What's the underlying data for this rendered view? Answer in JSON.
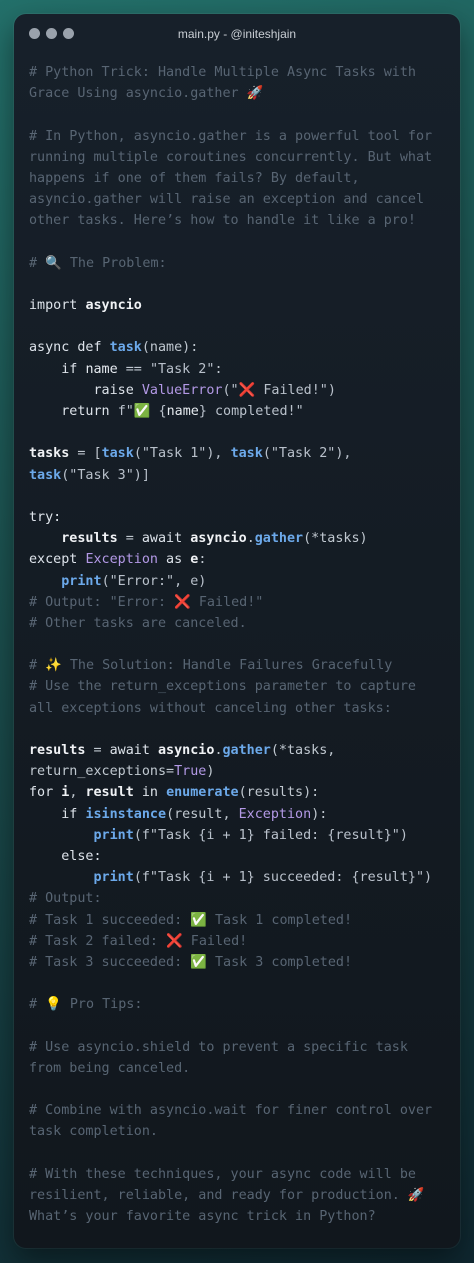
{
  "window": {
    "title": "main.py - @initeshjain"
  },
  "code_lines": [
    [
      {
        "t": "# Python Trick: Handle Multiple Async Tasks with",
        "c": "c"
      }
    ],
    [
      {
        "t": "Grace Using asyncio.gather 🚀",
        "c": "c"
      }
    ],
    [],
    [
      {
        "t": "# In Python, asyncio.gather is a powerful tool for",
        "c": "c"
      }
    ],
    [
      {
        "t": "running multiple coroutines concurrently. But what",
        "c": "c"
      }
    ],
    [
      {
        "t": "happens if one of them fails? By default,",
        "c": "c"
      }
    ],
    [
      {
        "t": "asyncio.gather will raise an exception and cancel",
        "c": "c"
      }
    ],
    [
      {
        "t": "other tasks. Here’s how to handle it like a pro!",
        "c": "c"
      }
    ],
    [],
    [
      {
        "t": "# 🔍 The Problem:",
        "c": "c"
      }
    ],
    [],
    [
      {
        "t": "import ",
        "c": "k"
      },
      {
        "t": "asyncio",
        "c": "m"
      }
    ],
    [],
    [
      {
        "t": "async def ",
        "c": "k"
      },
      {
        "t": "task",
        "c": "f"
      },
      {
        "t": "(name):",
        "c": "o"
      }
    ],
    [
      {
        "t": "    if ",
        "c": "k"
      },
      {
        "t": "name",
        "c": "v"
      },
      {
        "t": " == ",
        "c": "o"
      },
      {
        "t": "\"Task 2\"",
        "c": "s"
      },
      {
        "t": ":",
        "c": "o"
      }
    ],
    [
      {
        "t": "        raise ",
        "c": "k"
      },
      {
        "t": "ValueError",
        "c": "cl"
      },
      {
        "t": "(\"❌ Failed!\")",
        "c": "s"
      }
    ],
    [
      {
        "t": "    return ",
        "c": "k"
      },
      {
        "t": "f\"✅ {",
        "c": "s"
      },
      {
        "t": "name",
        "c": "v"
      },
      {
        "t": "} completed!\"",
        "c": "s"
      }
    ],
    [],
    [
      {
        "t": "tasks",
        "c": "m"
      },
      {
        "t": " = [",
        "c": "o"
      },
      {
        "t": "task",
        "c": "f"
      },
      {
        "t": "(\"Task 1\"), ",
        "c": "s"
      },
      {
        "t": "task",
        "c": "f"
      },
      {
        "t": "(\"Task 2\"),",
        "c": "s"
      }
    ],
    [
      {
        "t": "task",
        "c": "f"
      },
      {
        "t": "(\"Task 3\")]",
        "c": "s"
      }
    ],
    [],
    [
      {
        "t": "try:",
        "c": "k"
      }
    ],
    [
      {
        "t": "    results",
        "c": "m"
      },
      {
        "t": " = ",
        "c": "o"
      },
      {
        "t": "await ",
        "c": "k"
      },
      {
        "t": "asyncio",
        "c": "m"
      },
      {
        "t": ".",
        "c": "o"
      },
      {
        "t": "gather",
        "c": "f"
      },
      {
        "t": "(*tasks)",
        "c": "o"
      }
    ],
    [
      {
        "t": "except ",
        "c": "k"
      },
      {
        "t": "Exception",
        "c": "cl"
      },
      {
        "t": " as ",
        "c": "k"
      },
      {
        "t": "e",
        "c": "m"
      },
      {
        "t": ":",
        "c": "o"
      }
    ],
    [
      {
        "t": "    ",
        "c": "o"
      },
      {
        "t": "print",
        "c": "f"
      },
      {
        "t": "(\"Error:\", e)",
        "c": "s"
      }
    ],
    [
      {
        "t": "# Output: \"Error: ❌ Failed!\"",
        "c": "c"
      }
    ],
    [
      {
        "t": "# Other tasks are canceled.",
        "c": "c"
      }
    ],
    [],
    [
      {
        "t": "# ✨ The Solution: Handle Failures Gracefully",
        "c": "c"
      }
    ],
    [
      {
        "t": "# Use the return_exceptions parameter to capture",
        "c": "c"
      }
    ],
    [
      {
        "t": "all exceptions without canceling other tasks:",
        "c": "c"
      }
    ],
    [],
    [
      {
        "t": "results",
        "c": "m"
      },
      {
        "t": " = ",
        "c": "o"
      },
      {
        "t": "await ",
        "c": "k"
      },
      {
        "t": "asyncio",
        "c": "m"
      },
      {
        "t": ".",
        "c": "o"
      },
      {
        "t": "gather",
        "c": "f"
      },
      {
        "t": "(*tasks,",
        "c": "o"
      }
    ],
    [
      {
        "t": "return_exceptions=",
        "c": "o"
      },
      {
        "t": "True",
        "c": "b"
      },
      {
        "t": ")",
        "c": "o"
      }
    ],
    [
      {
        "t": "for ",
        "c": "k"
      },
      {
        "t": "i",
        "c": "m"
      },
      {
        "t": ", ",
        "c": "o"
      },
      {
        "t": "result",
        "c": "m"
      },
      {
        "t": " in ",
        "c": "k"
      },
      {
        "t": "enumerate",
        "c": "f"
      },
      {
        "t": "(results):",
        "c": "o"
      }
    ],
    [
      {
        "t": "    if ",
        "c": "k"
      },
      {
        "t": "isinstance",
        "c": "f"
      },
      {
        "t": "(result, ",
        "c": "o"
      },
      {
        "t": "Exception",
        "c": "cl"
      },
      {
        "t": "):",
        "c": "o"
      }
    ],
    [
      {
        "t": "        ",
        "c": "o"
      },
      {
        "t": "print",
        "c": "f"
      },
      {
        "t": "(f\"Task {i + 1} failed: {result}\")",
        "c": "s"
      }
    ],
    [
      {
        "t": "    else:",
        "c": "k"
      }
    ],
    [
      {
        "t": "        ",
        "c": "o"
      },
      {
        "t": "print",
        "c": "f"
      },
      {
        "t": "(f\"Task {i + 1} succeeded: {result}\")",
        "c": "s"
      }
    ],
    [
      {
        "t": "# Output:",
        "c": "c"
      }
    ],
    [
      {
        "t": "# Task 1 succeeded: ✅ Task 1 completed!",
        "c": "c"
      }
    ],
    [
      {
        "t": "# Task 2 failed: ❌ Failed!",
        "c": "c"
      }
    ],
    [
      {
        "t": "# Task 3 succeeded: ✅ Task 3 completed!",
        "c": "c"
      }
    ],
    [],
    [
      {
        "t": "# 💡 Pro Tips:",
        "c": "c"
      }
    ],
    [],
    [
      {
        "t": "# Use asyncio.shield to prevent a specific task",
        "c": "c"
      }
    ],
    [
      {
        "t": "from being canceled.",
        "c": "c"
      }
    ],
    [],
    [
      {
        "t": "# Combine with asyncio.wait for finer control over",
        "c": "c"
      }
    ],
    [
      {
        "t": "task completion.",
        "c": "c"
      }
    ],
    [],
    [
      {
        "t": "# With these techniques, your async code will be",
        "c": "c"
      }
    ],
    [
      {
        "t": "resilient, reliable, and ready for production. 🚀",
        "c": "c"
      }
    ],
    [
      {
        "t": "What’s your favorite async trick in Python?",
        "c": "c"
      }
    ]
  ]
}
